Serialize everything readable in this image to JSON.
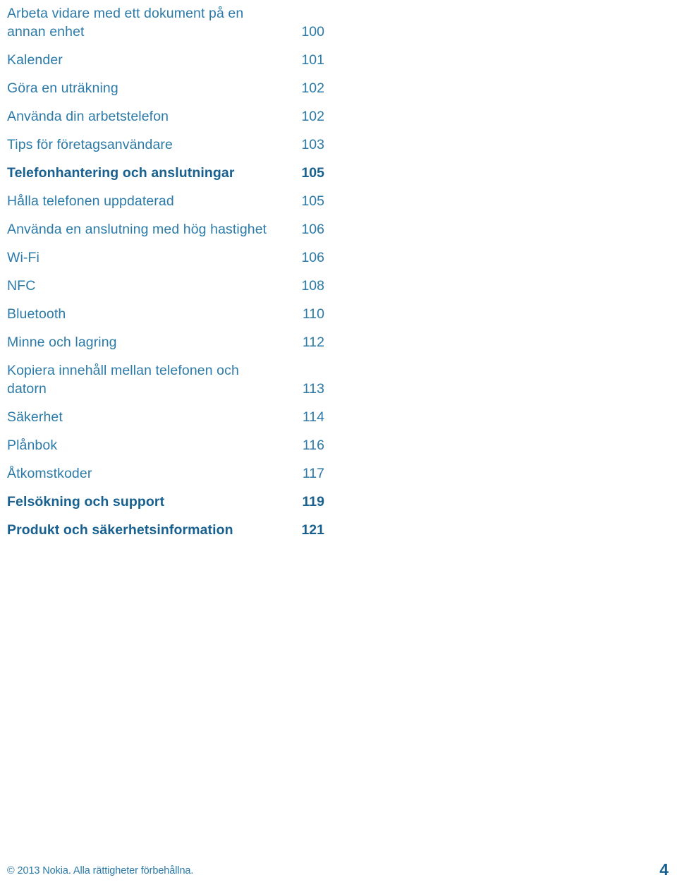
{
  "document": {
    "type": "table-of-contents",
    "language": "sv"
  },
  "colors": {
    "entry_blue": "#2b7aa8",
    "section_blue": "#18608f",
    "background": "#ffffff"
  },
  "toc": {
    "entries": [
      {
        "title": "Arbeta vidare med ett dokument på en annan enhet",
        "page": "100",
        "level": "entry",
        "lines": 2
      },
      {
        "title": "Kalender",
        "page": "101",
        "level": "entry",
        "lines": 1
      },
      {
        "title": "Göra en uträkning",
        "page": "102",
        "level": "entry",
        "lines": 1
      },
      {
        "title": "Använda din arbetstelefon",
        "page": "102",
        "level": "entry",
        "lines": 1
      },
      {
        "title": "Tips för företagsanvändare",
        "page": "103",
        "level": "entry",
        "lines": 1
      },
      {
        "title": "Telefonhantering och anslutningar",
        "page": "105",
        "level": "section",
        "lines": 1
      },
      {
        "title": "Hålla telefonen uppdaterad",
        "page": "105",
        "level": "entry",
        "lines": 1
      },
      {
        "title": "Använda en anslutning med hög hastighet",
        "page": "106",
        "level": "entry",
        "lines": 2
      },
      {
        "title": "Wi-Fi",
        "page": "106",
        "level": "entry",
        "lines": 1
      },
      {
        "title": "NFC",
        "page": "108",
        "level": "entry",
        "lines": 1
      },
      {
        "title": "Bluetooth",
        "page": "110",
        "level": "entry",
        "lines": 1
      },
      {
        "title": "Minne och lagring",
        "page": "112",
        "level": "entry",
        "lines": 1
      },
      {
        "title": "Kopiera innehåll mellan telefonen och datorn",
        "page": "113",
        "level": "entry",
        "lines": 2
      },
      {
        "title": "Säkerhet",
        "page": "114",
        "level": "entry",
        "lines": 1
      },
      {
        "title": "Plånbok",
        "page": "116",
        "level": "entry",
        "lines": 1
      },
      {
        "title": "Åtkomstkoder",
        "page": "117",
        "level": "entry",
        "lines": 1
      },
      {
        "title": "Felsökning och support",
        "page": "119",
        "level": "section",
        "lines": 1
      },
      {
        "title": "Produkt och säkerhetsinformation",
        "page": "121",
        "level": "section",
        "lines": 1
      }
    ]
  },
  "footer": {
    "copyright": "© 2013 Nokia. Alla rättigheter förbehållna.",
    "page_number": "4"
  }
}
